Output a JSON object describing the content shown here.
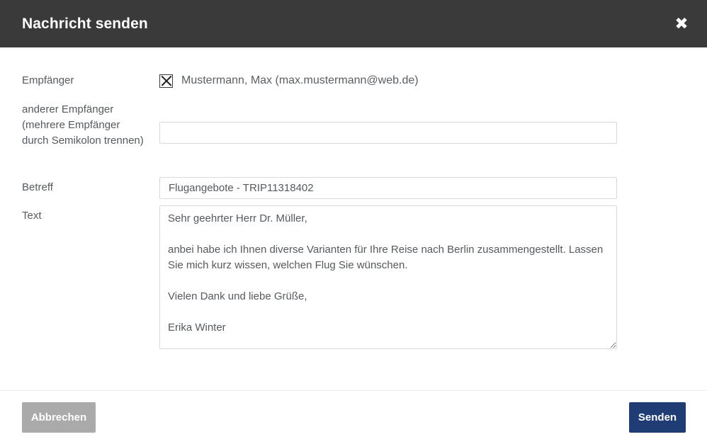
{
  "dialog": {
    "title": "Nachricht senden",
    "close_icon": "close-icon",
    "close_glyph": "✖"
  },
  "form": {
    "recipient": {
      "label": "Empfänger",
      "checkbox_checked": true,
      "checkbox_glyph": "X",
      "value": "Mustermann, Max (max.mustermann@web.de)"
    },
    "other_recipient": {
      "label": "anderer Empfänger (mehrere Empfänger durch Semikolon trennen)",
      "value": "",
      "placeholder": ""
    },
    "subject": {
      "label": "Betreff",
      "value": "Flugangebote - TRIP11318402",
      "placeholder": ""
    },
    "text": {
      "label": "Text",
      "value": "Sehr geehrter Herr Dr. Müller,\n\nanbei habe ich Ihnen diverse Varianten für Ihre Reise nach Berlin zusammengestellt. Lassen Sie mich kurz wissen, welchen Flug Sie wünschen.\n\nVielen Dank und liebe Grüße,\n\nErika Winter",
      "placeholder": "",
      "resize_handle_icon": "resize-grip-icon"
    }
  },
  "footer": {
    "cancel_label": "Abbrechen",
    "send_label": "Senden"
  },
  "colors": {
    "header_bg": "#3a3a3a",
    "send_button_bg": "#1f3c74",
    "cancel_button_bg": "#aaaaaa",
    "label_text": "#555a5e",
    "input_border": "#d8dadc"
  }
}
